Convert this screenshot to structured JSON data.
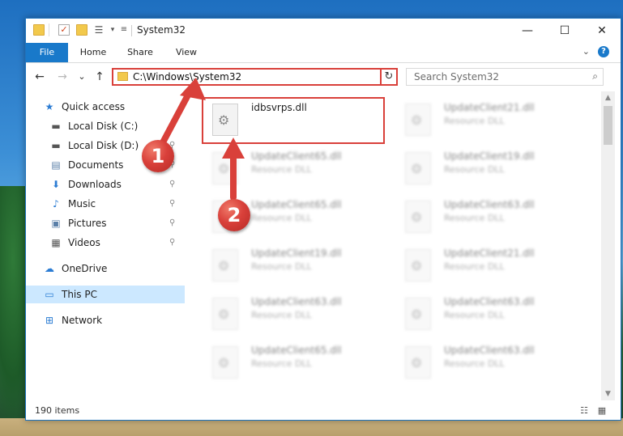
{
  "window": {
    "title": "System32",
    "minimize_glyph": "—",
    "maximize_glyph": "☐",
    "close_glyph": "✕"
  },
  "ribbon": {
    "tabs": [
      "File",
      "Home",
      "Share",
      "View"
    ],
    "expand_glyph": "⌄",
    "help_glyph": "?"
  },
  "addressbar": {
    "back_glyph": "←",
    "forward_glyph": "→",
    "recent_glyph": "⌄",
    "up_glyph": "↑",
    "path": "C:\\Windows\\System32",
    "dropdown_glyph": "⌄",
    "refresh_glyph": "↻"
  },
  "search": {
    "placeholder": "Search System32",
    "icon_glyph": "⌕"
  },
  "navpane": {
    "items": [
      {
        "label": "Quick access",
        "icon": "star-icon",
        "glyph": "★",
        "color": "#2b7cd3"
      },
      {
        "label": "Local Disk (C:)",
        "icon": "drive-icon",
        "glyph": "▬",
        "color": "#555555",
        "pinned": true
      },
      {
        "label": "Local Disk (D:)",
        "icon": "drive-icon",
        "glyph": "▬",
        "color": "#555555",
        "pinned": true
      },
      {
        "label": "Documents",
        "icon": "document-icon",
        "glyph": "▤",
        "color": "#5a7fa8",
        "pinned": true
      },
      {
        "label": "Downloads",
        "icon": "download-icon",
        "glyph": "⬇",
        "color": "#2b7cd3",
        "pinned": true
      },
      {
        "label": "Music",
        "icon": "music-icon",
        "glyph": "♪",
        "color": "#2b7cd3",
        "pinned": true
      },
      {
        "label": "Pictures",
        "icon": "pictures-icon",
        "glyph": "▣",
        "color": "#5a7fa8",
        "pinned": true
      },
      {
        "label": "Videos",
        "icon": "videos-icon",
        "glyph": "▦",
        "color": "#555555",
        "pinned": true
      },
      {
        "label": "OneDrive",
        "icon": "cloud-icon",
        "glyph": "☁",
        "color": "#2b7cd3"
      },
      {
        "label": "This PC",
        "icon": "computer-icon",
        "glyph": "▭",
        "color": "#2b7cd3",
        "selected": true
      },
      {
        "label": "Network",
        "icon": "network-icon",
        "glyph": "⊞",
        "color": "#2b7cd3"
      }
    ],
    "pin_glyph": "📌"
  },
  "files": [
    {
      "name": "idbsvrps.dll",
      "type": "",
      "highlighted": true
    },
    {
      "name": "UpdateClient21.dll",
      "type": "Resource DLL"
    },
    {
      "name": "UpdateClient65.dll",
      "type": "Resource DLL"
    },
    {
      "name": "UpdateClient19.dll",
      "type": "Resource DLL"
    },
    {
      "name": "UpdateClient65.dll",
      "type": "Resource DLL"
    },
    {
      "name": "UpdateClient63.dll",
      "type": "Resource DLL"
    },
    {
      "name": "UpdateClient19.dll",
      "type": "Resource DLL"
    },
    {
      "name": "UpdateClient21.dll",
      "type": "Resource DLL"
    },
    {
      "name": "UpdateClient63.dll",
      "type": "Resource DLL"
    },
    {
      "name": "UpdateClient63.dll",
      "type": "Resource DLL"
    },
    {
      "name": "UpdateClient65.dll",
      "type": "Resource DLL"
    },
    {
      "name": "UpdateClient63.dll",
      "type": "Resource DLL"
    }
  ],
  "gear_glyph": "⚙",
  "statusbar": {
    "item_count": "190 items",
    "details_view_glyph": "☷",
    "tiles_view_glyph": "▦"
  },
  "callouts": [
    "1",
    "2"
  ],
  "colors": {
    "accent": "#1979ca",
    "highlight_red": "#d9403a",
    "selected_bg": "#cce8ff"
  }
}
